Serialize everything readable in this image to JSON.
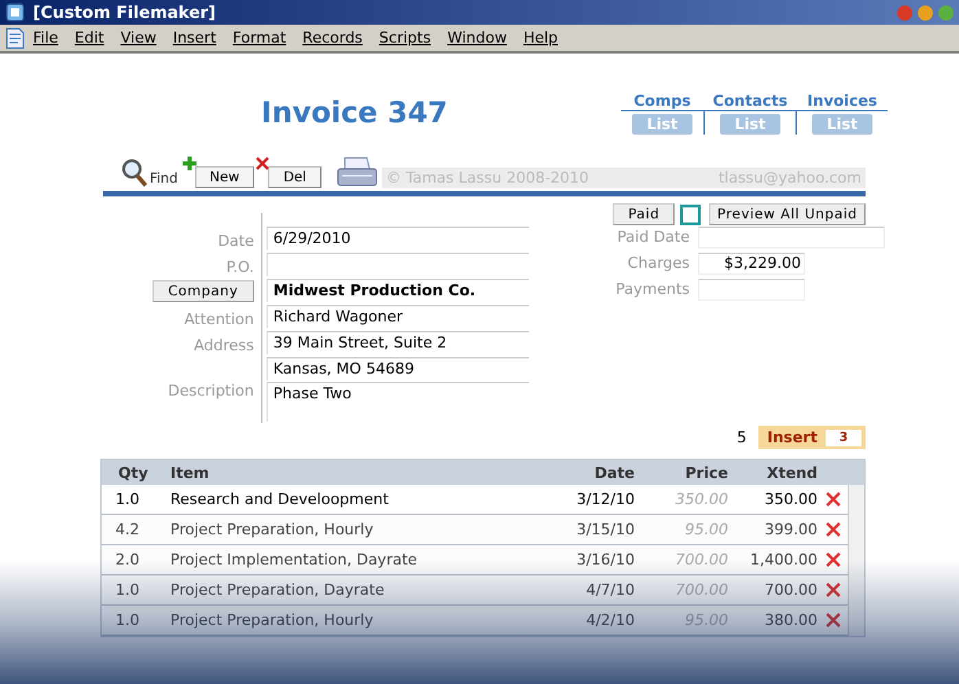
{
  "window": {
    "title": "[Custom Filemaker]"
  },
  "menu": [
    "File",
    "Edit",
    "View",
    "Insert",
    "Format",
    "Records",
    "Scripts",
    "Window",
    "Help"
  ],
  "title": "Invoice 347",
  "nav": [
    {
      "label": "Comps",
      "button": "List"
    },
    {
      "label": "Contacts",
      "button": "List"
    },
    {
      "label": "Invoices",
      "button": "List"
    }
  ],
  "toolbar": {
    "find": "Find",
    "new": "New",
    "del": "Del",
    "copyright": "© Tamas Lassu 2008-2010",
    "email": "tlassu@yahoo.com"
  },
  "paid_button": "Paid",
  "paid": false,
  "preview_button": "Preview All Unpaid",
  "fields": [
    {
      "kind": "label",
      "label": "Date",
      "value": "6/29/2010"
    },
    {
      "kind": "label",
      "label": "P.O."
    },
    {
      "kind": "button",
      "label": "Company",
      "value": "Midwest Production Co."
    },
    {
      "kind": "label",
      "label": "Attention",
      "value": "Richard Wagoner"
    },
    {
      "kind": "label",
      "label": "Address",
      "value": "39 Main Street, Suite 2"
    },
    {
      "kind": "none",
      "value": "Kansas, MO 54689"
    },
    {
      "kind": "area",
      "label": "Description",
      "value": "Phase Two"
    }
  ],
  "totals": [
    {
      "label": "Paid Date"
    },
    {
      "label": "Charges",
      "value": "$3,229.00"
    },
    {
      "label": "Payments"
    }
  ],
  "line_count": "5",
  "insert": {
    "label": "Insert",
    "count": "3"
  },
  "table": {
    "columns": [
      "Qty",
      "Item",
      "Date",
      "Price",
      "Xtend"
    ],
    "rows": [
      {
        "qty": "1.0",
        "item": "Research and Develoopment",
        "date": "3/12/10",
        "price": "350.00",
        "xtend": "350.00",
        "selected": true
      },
      {
        "qty": "4.2",
        "item": "Project Preparation, Hourly",
        "date": "3/15/10",
        "price": "95.00",
        "xtend": "399.00",
        "selected": false
      },
      {
        "qty": "2.0",
        "item": "Project Implementation, Dayrate",
        "date": "3/16/10",
        "price": "700.00",
        "xtend": "1,400.00",
        "selected": false
      },
      {
        "qty": "1.0",
        "item": "Project Preparation, Dayrate",
        "date": "4/7/10",
        "price": "700.00",
        "xtend": "700.00",
        "selected": false
      },
      {
        "qty": "1.0",
        "item": "Project Preparation, Hourly",
        "date": "4/2/10",
        "price": "95.00",
        "xtend": "380.00",
        "selected": false
      }
    ]
  }
}
